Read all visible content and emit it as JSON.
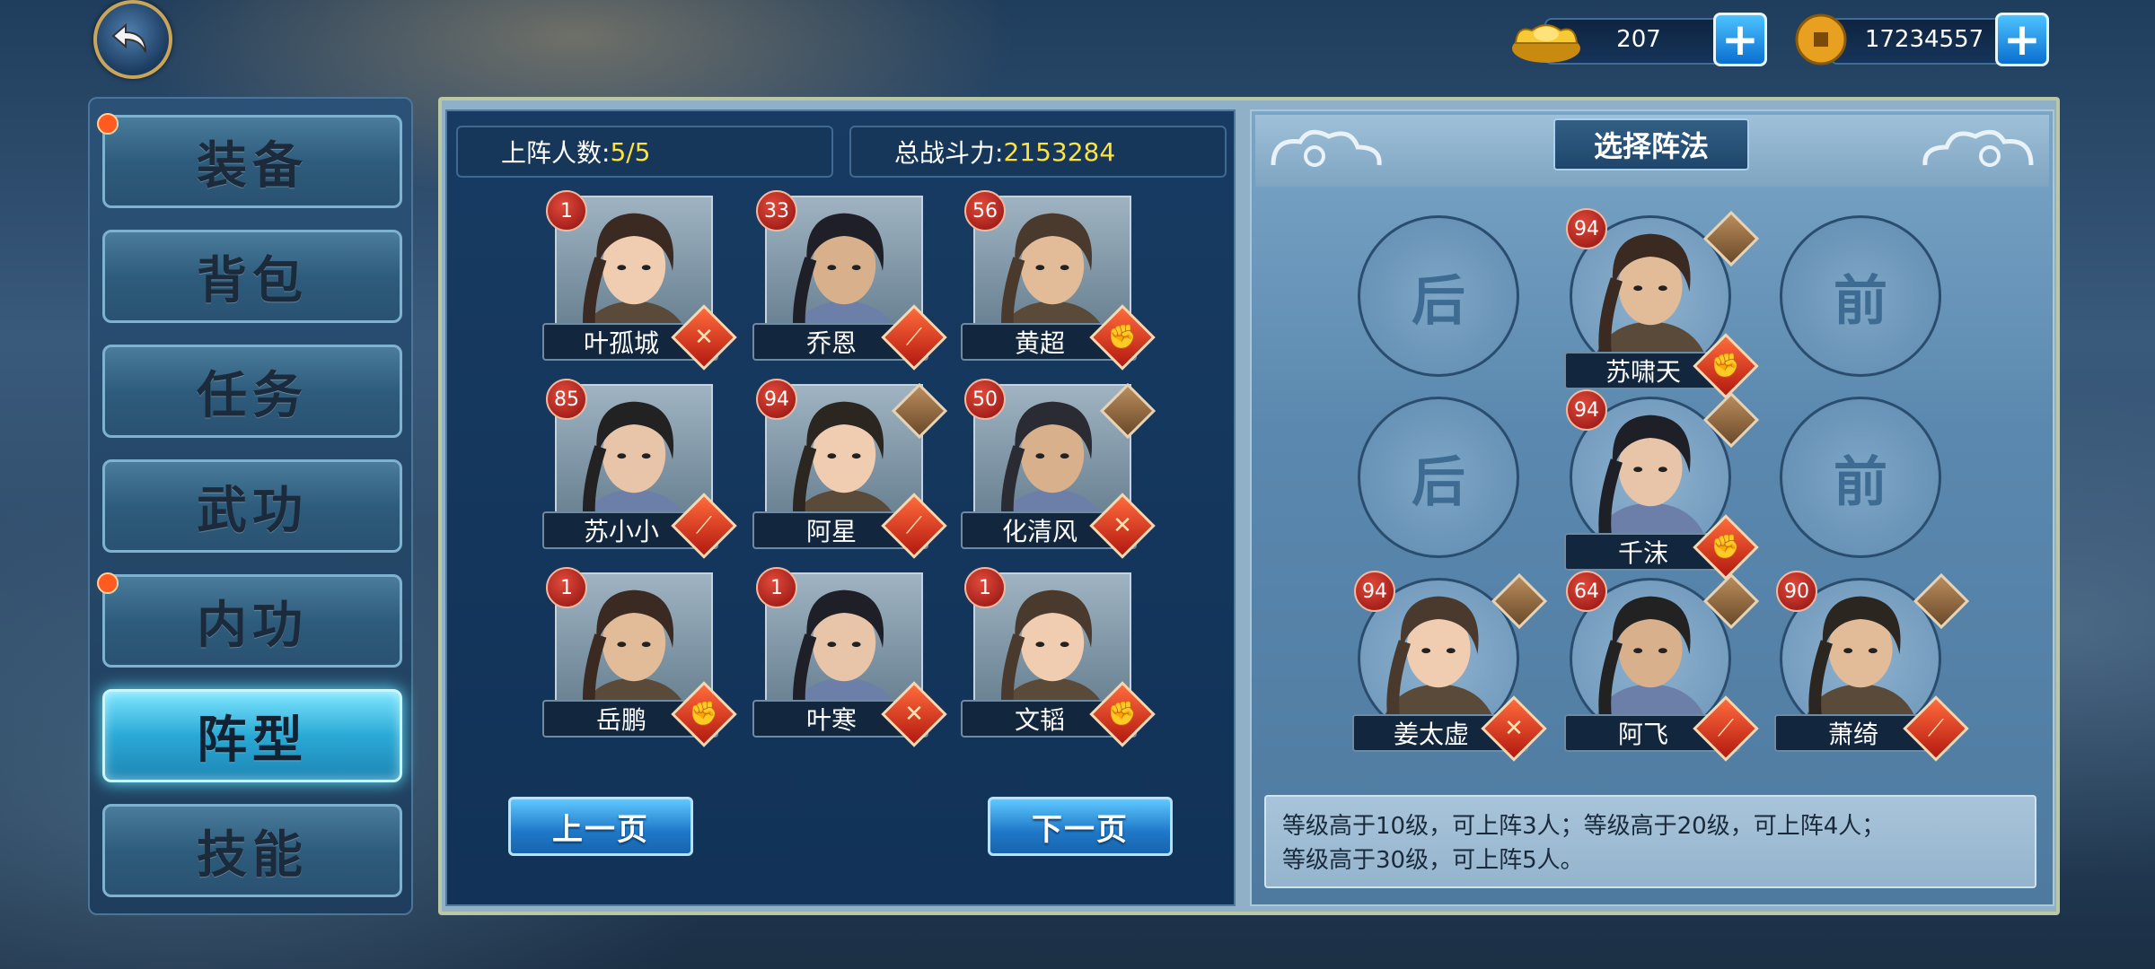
{
  "currency": {
    "gold": {
      "value": "207",
      "icon": "gold-ingot-icon"
    },
    "coin": {
      "value": "17234557",
      "icon": "copper-coin-icon"
    },
    "plus": "+"
  },
  "sidebar": {
    "items": [
      {
        "label": "装备",
        "dot": true
      },
      {
        "label": "背包",
        "dot": false
      },
      {
        "label": "任务",
        "dot": false
      },
      {
        "label": "武功",
        "dot": false
      },
      {
        "label": "内功",
        "dot": true
      },
      {
        "label": "阵型",
        "dot": false,
        "active": true
      },
      {
        "label": "技能",
        "dot": false
      }
    ]
  },
  "stats": {
    "deploy_label": "上阵人数:",
    "deploy_value": "5/5",
    "power_label": "总战斗力:",
    "power_value": "2153284"
  },
  "roster": [
    {
      "name": "叶孤城",
      "level": "1",
      "type": "sword",
      "glyph": "✕"
    },
    {
      "name": "乔恩",
      "level": "33",
      "type": "spear",
      "glyph": "⟋"
    },
    {
      "name": "黄超",
      "level": "56",
      "type": "fist",
      "glyph": "✊"
    },
    {
      "name": "苏小小",
      "level": "85",
      "type": "spear",
      "glyph": "⟋"
    },
    {
      "name": "阿星",
      "level": "94",
      "type": "spear",
      "glyph": "⟋",
      "pet": true
    },
    {
      "name": "化清风",
      "level": "50",
      "type": "sword",
      "glyph": "✕",
      "pet": true
    },
    {
      "name": "岳鹏",
      "level": "1",
      "type": "fist",
      "glyph": "✊"
    },
    {
      "name": "叶寒",
      "level": "1",
      "type": "sword",
      "glyph": "✕"
    },
    {
      "name": "文韬",
      "level": "1",
      "type": "fist",
      "glyph": "✊"
    }
  ],
  "pagination": {
    "prev": "上一页",
    "next": "下一页"
  },
  "formation": {
    "title": "选择阵法",
    "empty_slots": [
      "后",
      "前",
      "后",
      "前"
    ],
    "members": [
      {
        "name": "苏啸天",
        "level": "94",
        "glyph": "✊"
      },
      {
        "name": "千沫",
        "level": "94",
        "glyph": "✊"
      },
      {
        "name": "姜太虚",
        "level": "94",
        "glyph": "✕"
      },
      {
        "name": "阿飞",
        "level": "64",
        "glyph": "⟋"
      },
      {
        "name": "萧绮",
        "level": "90",
        "glyph": "⟋"
      }
    ],
    "info_line1": "等级高于10级，可上阵3人；等级高于20级，可上阵4人；",
    "info_line2": "等级高于30级，可上阵5人。"
  },
  "colors": {
    "accent": "#ffe23a",
    "badge": "#c4281a",
    "active_tab": "#2aa9d6"
  }
}
